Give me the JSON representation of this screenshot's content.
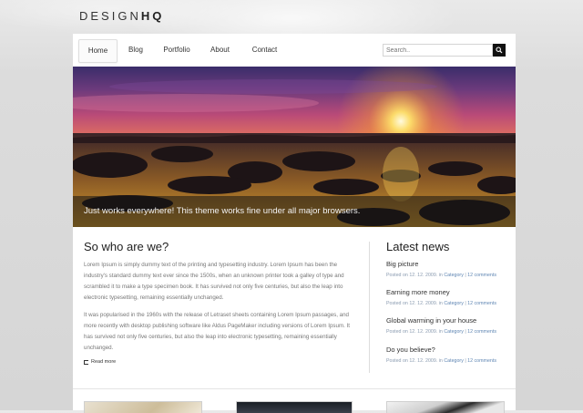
{
  "brand": {
    "logo_light": "DESIGN",
    "logo_bold": "HQ"
  },
  "nav": {
    "items": [
      {
        "label": "Home",
        "active": true
      },
      {
        "label": "Blog",
        "active": false
      },
      {
        "label": "Portfolio",
        "active": false
      },
      {
        "label": "About",
        "active": false
      },
      {
        "label": "Contact",
        "active": false
      }
    ]
  },
  "search": {
    "placeholder": "Search..",
    "button_icon": "magnifier-icon"
  },
  "hero": {
    "caption": "Just works everywhere! This theme works fine under all major browsers."
  },
  "about": {
    "title": "So who are we?",
    "paragraphs": [
      "Lorem Ipsum is simply dummy text of the printing and typesetting industry. Lorem Ipsum has been the industry's standard dummy text ever since the 1500s, when an unknown printer took a galley of type and scrambled it to make a type specimen book. It has survived not only five centuries, but also the leap into electronic typesetting, remaining essentially unchanged.",
      "It was popularised in the 1960s with the release of Letraset sheets containing Lorem Ipsum passages, and more recently with desktop publishing software like Aldus PageMaker including versions of Lorem Ipsum. It has survived not only five centuries, but also the leap into electronic typesetting, remaining essentially unchanged."
    ],
    "read_more": "Read more"
  },
  "news": {
    "title": "Latest news",
    "items": [
      {
        "headline": "Big picture",
        "posted": "Posted on 12. 12. 2009. in",
        "category": "Category",
        "comments": "12 comments"
      },
      {
        "headline": "Earning more money",
        "posted": "Posted on 12. 12. 2009. in",
        "category": "Category",
        "comments": "12 comments"
      },
      {
        "headline": "Global warming in your house",
        "posted": "Posted on 12. 12. 2009. in",
        "category": "Category",
        "comments": "12 comments"
      },
      {
        "headline": "Do you believe?",
        "posted": "Posted on 12. 12. 2009. in",
        "category": "Category",
        "comments": "12 comments"
      }
    ]
  },
  "colors": {
    "accent": "#5f86b3",
    "dark": "#111111",
    "page_bg": "#dcdcdc"
  }
}
